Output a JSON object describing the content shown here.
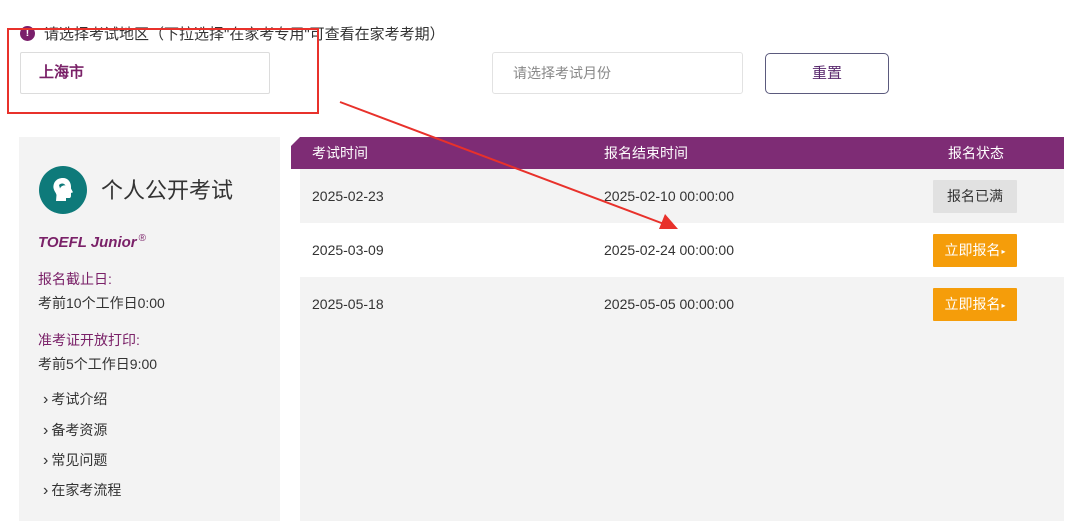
{
  "notice": {
    "text": "请选择考试地区（下拉选择\"在家考专用\"可查看在家考考期）",
    "icon": "exclamation-icon"
  },
  "filters": {
    "region_value": "上海市",
    "month_placeholder": "请选择考试月份",
    "reset_label": "重置"
  },
  "sidebar": {
    "logo_icon": "head-silhouette-icon",
    "title": "个人公开考试",
    "exam_name": "TOEFL Junior",
    "exam_mark": "®",
    "deadline_label": "报名截止日:",
    "deadline_value": "考前10个工作日0:00",
    "ticket_label": "准考证开放打印:",
    "ticket_value": "考前5个工作日9:00",
    "links": [
      "考试介绍",
      "备考资源",
      "常见问题",
      "在家考流程"
    ]
  },
  "table": {
    "headers": {
      "date": "考试时间",
      "deadline": "报名结束时间",
      "status": "报名状态"
    },
    "rows": [
      {
        "date": "2025-02-23",
        "deadline": "2025-02-10 00:00:00",
        "status": "报名已满"
      },
      {
        "date": "2025-03-09",
        "deadline": "2025-02-24 00:00:00",
        "status": "立即报名"
      },
      {
        "date": "2025-05-18",
        "deadline": "2025-05-05 00:00:00",
        "status": "立即报名"
      }
    ]
  },
  "colors": {
    "brand_purple": "#7e2c75",
    "accent_orange": "#f59d0a",
    "annotation_red": "#e8312b",
    "logo_teal": "#0e7a7a"
  }
}
